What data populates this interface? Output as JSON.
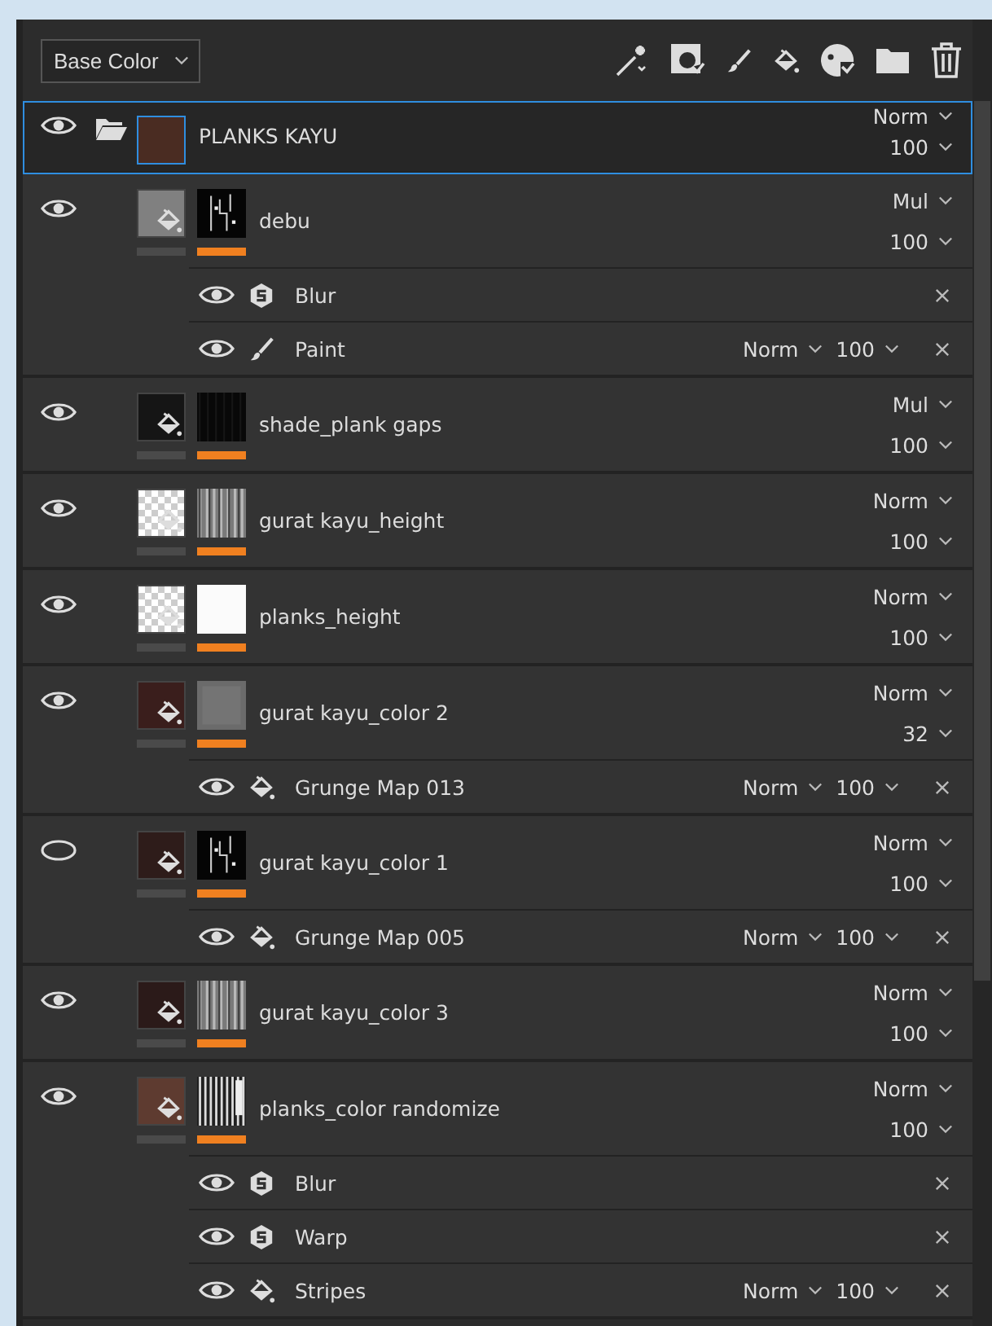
{
  "channel_dropdown": {
    "value": "Base Color"
  },
  "layers": [
    {
      "kind": "folder",
      "name": "PLANKS KAYU",
      "selected": true,
      "visible": true,
      "color": "#4a2c22",
      "blend": "Norm",
      "opacity": "100"
    },
    {
      "kind": "fill",
      "name": "debu",
      "selected": false,
      "visible": true,
      "color": "#808080",
      "mask": {
        "kind": "speckle"
      },
      "blend": "Mul",
      "opacity": "100",
      "effects": [
        {
          "kind": "filter",
          "name": "Blur",
          "visible": true
        },
        {
          "kind": "paint",
          "name": "Paint",
          "visible": true,
          "blend": "Norm",
          "opacity": "100"
        }
      ]
    },
    {
      "kind": "fill",
      "name": "shade_plank gaps",
      "selected": false,
      "visible": true,
      "color": "#151515",
      "mask": {
        "kind": "black"
      },
      "blend": "Mul",
      "opacity": "100"
    },
    {
      "kind": "fill",
      "name": "gurat kayu_height",
      "selected": false,
      "visible": true,
      "mask": {
        "kind": "grain"
      },
      "blend": "Norm",
      "opacity": "100"
    },
    {
      "kind": "fill",
      "name": "planks_height",
      "selected": false,
      "visible": true,
      "mask": {
        "kind": "white"
      },
      "blend": "Norm",
      "opacity": "100"
    },
    {
      "kind": "fill",
      "name": "gurat kayu_color 2",
      "selected": false,
      "visible": true,
      "color": "#3a1e1c",
      "mask": {
        "kind": "gray"
      },
      "blend": "Norm",
      "opacity": "32",
      "effects": [
        {
          "kind": "fill",
          "name": "Grunge Map 013",
          "visible": true,
          "blend": "Norm",
          "opacity": "100"
        }
      ]
    },
    {
      "kind": "fill",
      "name": "gurat kayu_color 1",
      "selected": false,
      "visible": false,
      "color": "#2e1c1a",
      "mask": {
        "kind": "speckle"
      },
      "blend": "Norm",
      "opacity": "100",
      "effects": [
        {
          "kind": "fill",
          "name": "Grunge Map 005",
          "visible": true,
          "blend": "Norm",
          "opacity": "100"
        }
      ]
    },
    {
      "kind": "fill",
      "name": "gurat kayu_color 3",
      "selected": false,
      "visible": true,
      "color": "#2b1a19",
      "mask": {
        "kind": "grain"
      },
      "blend": "Norm",
      "opacity": "100"
    },
    {
      "kind": "fill",
      "name": "planks_color randomize",
      "selected": false,
      "visible": true,
      "color": "#5e3b30",
      "mask": {
        "kind": "stripes"
      },
      "blend": "Norm",
      "opacity": "100",
      "effects": [
        {
          "kind": "filter",
          "name": "Blur",
          "visible": true
        },
        {
          "kind": "filter",
          "name": "Warp",
          "visible": true
        },
        {
          "kind": "fill",
          "name": "Stripes",
          "visible": true,
          "blend": "Norm",
          "opacity": "100"
        }
      ]
    }
  ]
}
